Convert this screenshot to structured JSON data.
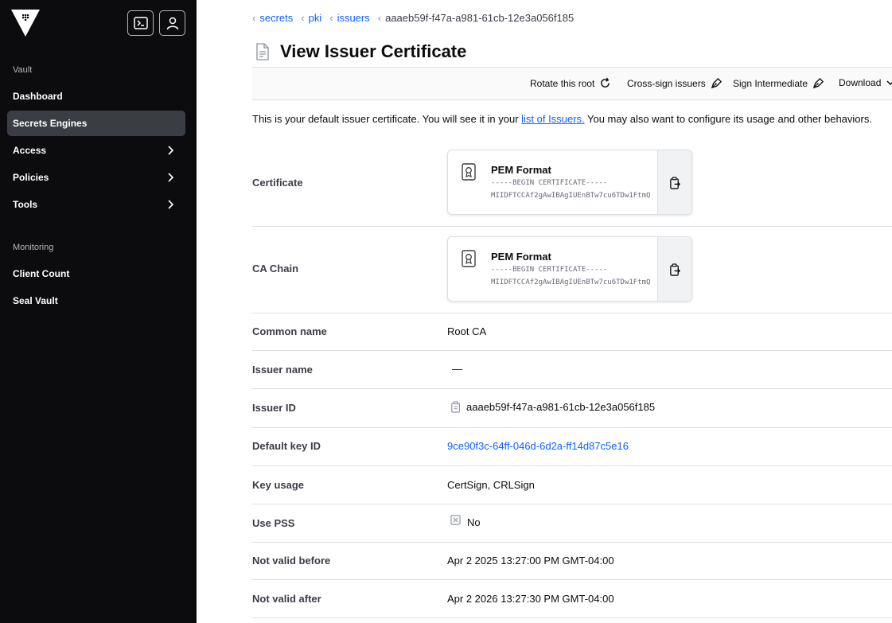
{
  "sidebar": {
    "sections": [
      {
        "label": "Vault"
      },
      {
        "label": "Monitoring"
      }
    ],
    "items": [
      {
        "label": "Dashboard"
      },
      {
        "label": "Secrets Engines"
      },
      {
        "label": "Access"
      },
      {
        "label": "Policies"
      },
      {
        "label": "Tools"
      },
      {
        "label": "Client Count"
      },
      {
        "label": "Seal Vault"
      }
    ]
  },
  "breadcrumb": [
    "secrets",
    "pki",
    "issuers",
    "aaaeb59f-f47a-a981-61cb-12e3a056f185"
  ],
  "page_title": "View Issuer Certificate",
  "toolbar": {
    "rotate": "Rotate this root",
    "cross_sign": "Cross-sign issuers",
    "sign_intermediate": "Sign Intermediate",
    "download": "Download"
  },
  "intro": {
    "before": "This is your default issuer certificate. You will see it in your ",
    "link": "list of Issuers.",
    "after": " You may also want to configure its usage and other behaviors."
  },
  "certificate": {
    "label": "Certificate",
    "format": "PEM Format",
    "line1": "-----BEGIN CERTIFICATE-----",
    "line2": "MIIDFTCCAf2gAwIBAgIUEnBTw7cu6TDw1FtmQ"
  },
  "ca_chain": {
    "label": "CA Chain",
    "format": "PEM Format",
    "line1": "-----BEGIN CERTIFICATE-----",
    "line2": "MIIDFTCCAf2gAwIBAgIUEnBTw7cu6TDw1FtmQ"
  },
  "fields": {
    "common_name": {
      "label": "Common name",
      "value": "Root CA"
    },
    "issuer_name": {
      "label": "Issuer name",
      "value": "—"
    },
    "issuer_id": {
      "label": "Issuer ID",
      "value": "aaaeb59f-f47a-a981-61cb-12e3a056f185"
    },
    "default_key_id": {
      "label": "Default key ID",
      "value": "9ce90f3c-64ff-046d-6d2a-ff14d87c5e16"
    },
    "key_usage": {
      "label": "Key usage",
      "value": "CertSign, CRLSign"
    },
    "use_pss": {
      "label": "Use PSS",
      "value": "No"
    },
    "not_before": {
      "label": "Not valid before",
      "value": "Apr 2 2025 13:27:00 PM GMT-04:00"
    },
    "not_after": {
      "label": "Not valid after",
      "value": "Apr 2 2026 13:27:30 PM GMT-04:00"
    }
  },
  "colors": {
    "sidebar_bg": "#0c0c0e",
    "active_nav": "#3b3d45",
    "link": "#1060ff",
    "border": "#dedfe3"
  },
  "icons": [
    "vault-logo-icon",
    "terminal-icon",
    "user-icon",
    "chevron-right-icon",
    "file-icon",
    "rotate-icon",
    "pen-icon",
    "chevron-down-icon",
    "certificate-icon",
    "clipboard-copy-icon",
    "x-square-icon"
  ]
}
